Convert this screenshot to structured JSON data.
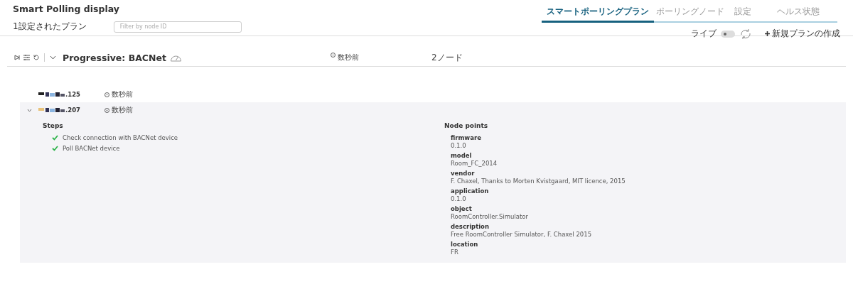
{
  "title": "Smart Polling display",
  "tabs": [
    {
      "label": "スマートポーリングプラン",
      "selected": true
    },
    {
      "label": "ポーリングノード",
      "selected": false
    },
    {
      "label": "設定",
      "selected": false
    },
    {
      "label": "ヘルス状態",
      "selected": false
    }
  ],
  "plan_count": "1設定されたプラン",
  "search": {
    "placeholder": "Filter by node ID"
  },
  "live": {
    "label": "ライブ",
    "on": false
  },
  "new_plan_button": "新規プランの作成",
  "plan": {
    "name": "Progressive: BACNet",
    "expanded": true,
    "time": "数秒前",
    "node_count": "2ノード"
  },
  "nodes": [
    {
      "id_suffix": ".125",
      "time": "数秒前",
      "expanded": false
    },
    {
      "id_suffix": ".207",
      "time": "数秒前",
      "expanded": true,
      "steps_heading": "Steps",
      "steps": [
        {
          "label": "Check connection with BACNet device",
          "done": true
        },
        {
          "label": "Poll BACNet device",
          "done": true
        }
      ],
      "points_heading": "Node points",
      "points": [
        {
          "key": "firmware",
          "value": "0.1.0"
        },
        {
          "key": "model",
          "value": "Room_FC_2014"
        },
        {
          "key": "vendor",
          "value": "F. Chaxel, Thanks to Morten Kvistgaard, MIT licence, 2015"
        },
        {
          "key": "application",
          "value": "0.1.0"
        },
        {
          "key": "object",
          "value": "RoomController.Simulator"
        },
        {
          "key": "description",
          "value": "Free RoomController Simulator, F. Chaxel 2015"
        },
        {
          "key": "location",
          "value": "FR"
        }
      ]
    }
  ]
}
